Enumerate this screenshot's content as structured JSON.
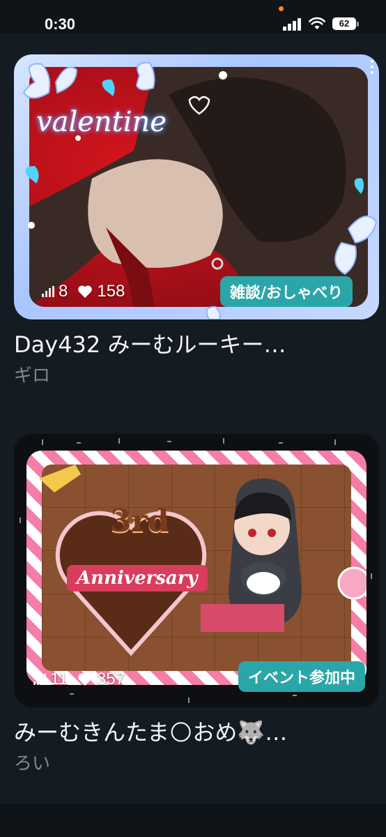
{
  "status": {
    "time": "0:30",
    "battery": "62"
  },
  "streams": [
    {
      "overlay_text": "valentine",
      "listeners": "8",
      "likes": "158",
      "tag": "雑談/おしゃべり",
      "title": "Day432 みーむルーキー…",
      "author": "ギロ"
    },
    {
      "overlay_text_1": "3rd",
      "overlay_text_2": "Anniversary",
      "listeners": "11",
      "likes": "357",
      "tag": "イベント参加中",
      "title": "みーむきんたま🌕おめ🐺…",
      "author": "ろい"
    }
  ]
}
